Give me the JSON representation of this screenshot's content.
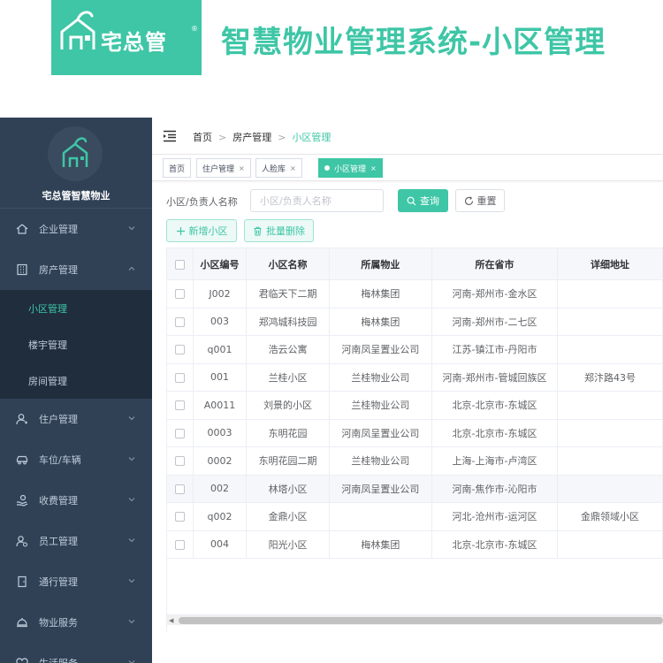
{
  "banner": {
    "logo_text": "宅总管",
    "logo_reg": "®",
    "title": "智慧物业管理系统-小区管理",
    "brand_color": "#3ec6a6"
  },
  "sidebar": {
    "company": "宅总管智慧物业",
    "bg_color": "#304156",
    "items": [
      {
        "label": "企业管理",
        "icon": "home-icon",
        "expanded": false
      },
      {
        "label": "房产管理",
        "icon": "building-icon",
        "expanded": true,
        "children": [
          {
            "label": "小区管理",
            "active": true
          },
          {
            "label": "楼宇管理",
            "active": false
          },
          {
            "label": "房间管理",
            "active": false
          }
        ]
      },
      {
        "label": "住户管理",
        "icon": "user-icon",
        "expanded": false
      },
      {
        "label": "车位/车辆",
        "icon": "car-icon",
        "expanded": false
      },
      {
        "label": "收费管理",
        "icon": "hand-coin-icon",
        "expanded": false
      },
      {
        "label": "员工管理",
        "icon": "staff-icon",
        "expanded": false
      },
      {
        "label": "通行管理",
        "icon": "door-icon",
        "expanded": false
      },
      {
        "label": "物业服务",
        "icon": "service-icon",
        "expanded": false
      },
      {
        "label": "生活服务",
        "icon": "life-icon",
        "expanded": false
      }
    ]
  },
  "breadcrumb": {
    "items": [
      "首页",
      "房产管理",
      "小区管理"
    ],
    "separator": ">"
  },
  "tags": [
    {
      "label": "首页",
      "closable": false,
      "active": false
    },
    {
      "label": "住户管理",
      "closable": true,
      "active": false
    },
    {
      "label": "人脸库",
      "closable": true,
      "active": false
    },
    {
      "label": "小区管理",
      "closable": true,
      "active": true
    }
  ],
  "tag_close": "×",
  "search": {
    "label": "小区/负责人名称",
    "placeholder": "小区/负责人名称",
    "value": "",
    "query_button": "查询",
    "reset_button": "重置"
  },
  "actions": {
    "add_button": "新增小区",
    "batch_delete_button": "批量删除"
  },
  "table": {
    "columns": [
      "小区编号",
      "小区名称",
      "所属物业",
      "所在省市",
      "详细地址"
    ],
    "rows": [
      [
        "J002",
        "君临天下二期",
        "梅林集团",
        "河南-郑州市-金水区",
        ""
      ],
      [
        "003",
        "郑鸿城科技园",
        "梅林集团",
        "河南-郑州市-二七区",
        ""
      ],
      [
        "q001",
        "浩云公寓",
        "河南凤呈置业公司",
        "江苏-镇江市-丹阳市",
        ""
      ],
      [
        "001",
        "兰桂小区",
        "兰桂物业公司",
        "河南-郑州市-管城回族区",
        "郑汴路43号"
      ],
      [
        "A0011",
        "刘景的小区",
        "兰桂物业公司",
        "北京-北京市-东城区",
        ""
      ],
      [
        "0003",
        "东明花园",
        "河南凤呈置业公司",
        "北京-北京市-东城区",
        ""
      ],
      [
        "0002",
        "东明花园二期",
        "兰桂物业公司",
        "上海-上海市-卢湾区",
        ""
      ],
      [
        "002",
        "林塔小区",
        "河南凤呈置业公司",
        "河南-焦作市-沁阳市",
        ""
      ],
      [
        "q002",
        "金鼎小区",
        "",
        "河北-沧州市-运河区",
        "金鼎领域小区"
      ],
      [
        "004",
        "阳光小区",
        "梅林集团",
        "北京-北京市-东城区",
        ""
      ]
    ],
    "highlight_row": 7
  }
}
